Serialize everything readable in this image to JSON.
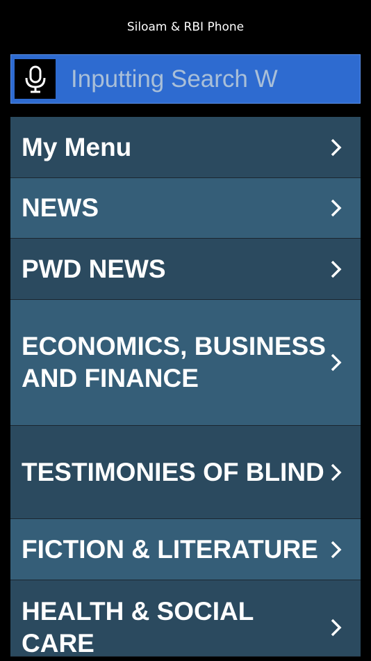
{
  "header": {
    "title": "Siloam & RBI Phone"
  },
  "search": {
    "placeholder": "Inputting Search W",
    "mic_icon": "microphone-icon"
  },
  "colors": {
    "search_bar": "#2e6bd0",
    "menu_dark": "#2b4a5f",
    "menu_light": "#355e78",
    "background": "#000000"
  },
  "menu": {
    "items": [
      {
        "label": "My Menu"
      },
      {
        "label": "NEWS"
      },
      {
        "label": "PWD NEWS"
      },
      {
        "label": "ECONOMICS, BUSINESS AND FINANCE"
      },
      {
        "label": "TESTIMONIES OF BLIND"
      },
      {
        "label": "FICTION & LITERATURE"
      },
      {
        "label": "HEALTH & SOCIAL CARE"
      }
    ],
    "chevron_icon": "chevron-right-icon"
  }
}
